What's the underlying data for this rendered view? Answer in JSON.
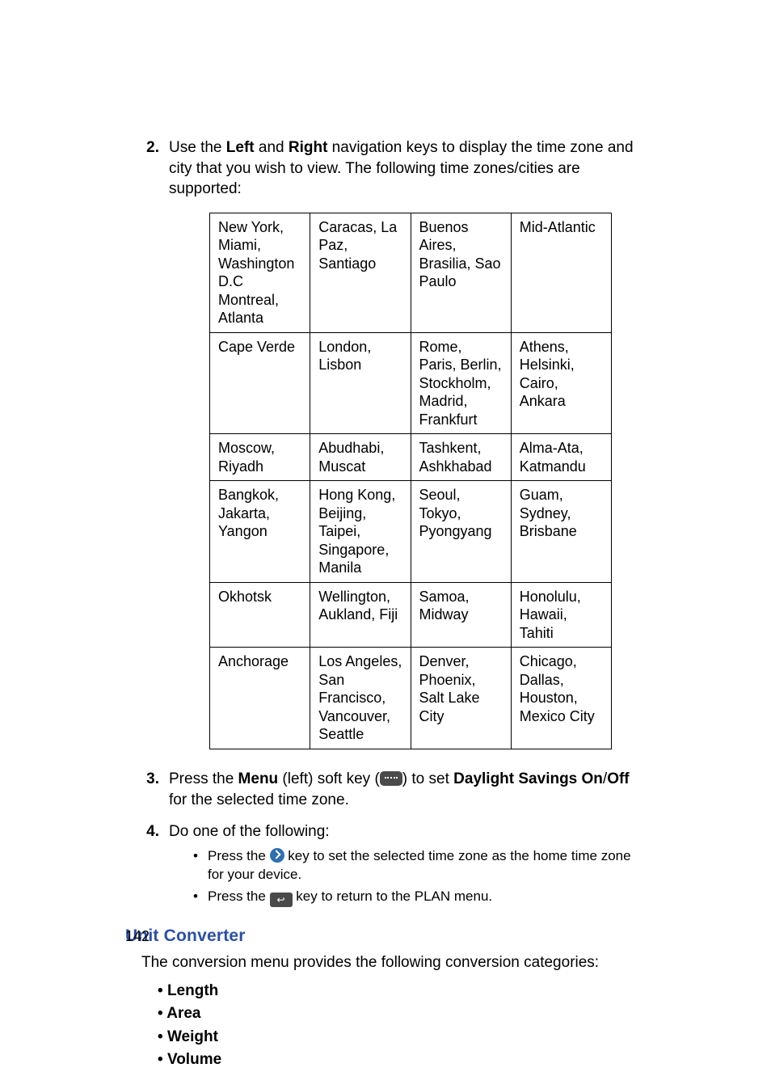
{
  "steps": {
    "s2": {
      "num": "2.",
      "pre": "Use the ",
      "b1": "Left",
      "mid1": " and ",
      "b2": "Right",
      "post": " navigation keys to display the time zone and city that you wish to view. The following time zones/cities are supported:"
    },
    "s3": {
      "num": "3.",
      "pre": "Press the ",
      "b1": "Menu",
      "mid1": " (left) soft key (",
      "mid2": ") to set ",
      "b2": "Daylight Savings On",
      "slash": "/",
      "b3": "Off",
      "post": " for the selected time zone."
    },
    "s4": {
      "num": "4.",
      "text": "Do one of the following:",
      "bullets": {
        "b1_pre": "Press the ",
        "b1_post": " key to set the selected time zone as the home time zone for your device.",
        "b2_pre": "Press the ",
        "b2_post": " key to return to the PLAN menu."
      }
    }
  },
  "table": {
    "rows": [
      [
        "New York, Miami, Washington D.C Montreal, Atlanta",
        "Caracas, La Paz, Santiago",
        "Buenos Aires, Brasilia, Sao Paulo",
        "Mid-Atlantic"
      ],
      [
        "Cape Verde",
        "London, Lisbon",
        "Rome, Paris, Berlin, Stockholm, Madrid, Frankfurt",
        "Athens, Helsinki, Cairo, Ankara"
      ],
      [
        "Moscow, Riyadh",
        "Abudhabi, Muscat",
        "Tashkent, Ashkhabad",
        "Alma-Ata, Katmandu"
      ],
      [
        "Bangkok, Jakarta, Yangon",
        "Hong Kong, Beijing, Taipei, Singapore, Manila",
        "Seoul, Tokyo, Pyongyang",
        "Guam, Sydney, Brisbane"
      ],
      [
        "Okhotsk",
        "Wellington, Aukland, Fiji",
        "Samoa, Midway",
        "Honolulu, Hawaii, Tahiti"
      ],
      [
        "Anchorage",
        "Los Angeles, San Francisco, Vancouver, Seattle",
        "Denver, Phoenix, Salt Lake City",
        "Chicago, Dallas, Houston, Mexico City"
      ]
    ]
  },
  "section": {
    "heading": "Unit Converter",
    "intro": "The conversion menu provides the following conversion categories:",
    "items": [
      "Length",
      "Area",
      "Weight",
      "Volume"
    ]
  },
  "return_glyph": "↩",
  "page_number": "142"
}
